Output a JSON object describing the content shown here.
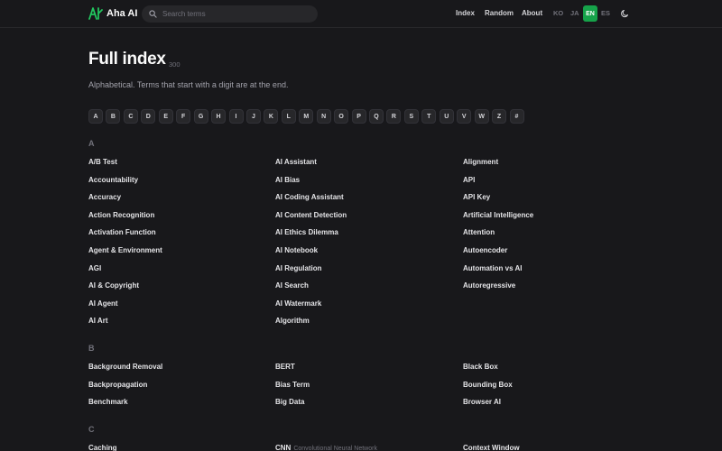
{
  "header": {
    "app_name": "Aha AI",
    "search_placeholder": "Search terms",
    "nav": [
      "Index",
      "Random",
      "About"
    ],
    "languages": [
      "KO",
      "JA",
      "EN",
      "ES"
    ],
    "active_language": "EN"
  },
  "page": {
    "title": "Full index",
    "count": "300",
    "subtitle": "Alphabetical. Terms that start with a digit are at the end."
  },
  "letters": [
    "A",
    "B",
    "C",
    "D",
    "E",
    "F",
    "G",
    "H",
    "I",
    "J",
    "K",
    "L",
    "M",
    "N",
    "O",
    "P",
    "Q",
    "R",
    "S",
    "T",
    "U",
    "V",
    "W",
    "Z",
    "#"
  ],
  "sections": [
    {
      "letter": "A",
      "columns": [
        [
          "A/B Test",
          "Accountability",
          "Accuracy",
          "Action Recognition",
          "Activation Function",
          "Agent & Environment",
          "AGI",
          "AI & Copyright",
          "AI Agent",
          "AI Art"
        ],
        [
          "AI Assistant",
          "AI Bias",
          "AI Coding Assistant",
          "AI Content Detection",
          "AI Ethics Dilemma",
          "AI Notebook",
          "AI Regulation",
          "AI Search",
          "AI Watermark",
          "Algorithm"
        ],
        [
          "Alignment",
          "API",
          "API Key",
          "Artificial Intelligence",
          "Attention",
          "Autoencoder",
          "Automation vs AI",
          "Autoregressive"
        ]
      ]
    },
    {
      "letter": "B",
      "columns": [
        [
          "Background Removal",
          "Backpropagation",
          "Benchmark"
        ],
        [
          "BERT",
          "Bias Term",
          "Big Data"
        ],
        [
          "Black Box",
          "Bounding Box",
          "Browser AI"
        ]
      ]
    },
    {
      "letter": "C",
      "columns": [
        [
          "Caching"
        ],
        [
          "CNN"
        ],
        [
          "Context Window"
        ]
      ],
      "cnn_sub": "Convolutional Neural Network"
    }
  ],
  "colors": {
    "accent": "#16a34a",
    "background": "#18181b",
    "chip": "#27272a"
  }
}
